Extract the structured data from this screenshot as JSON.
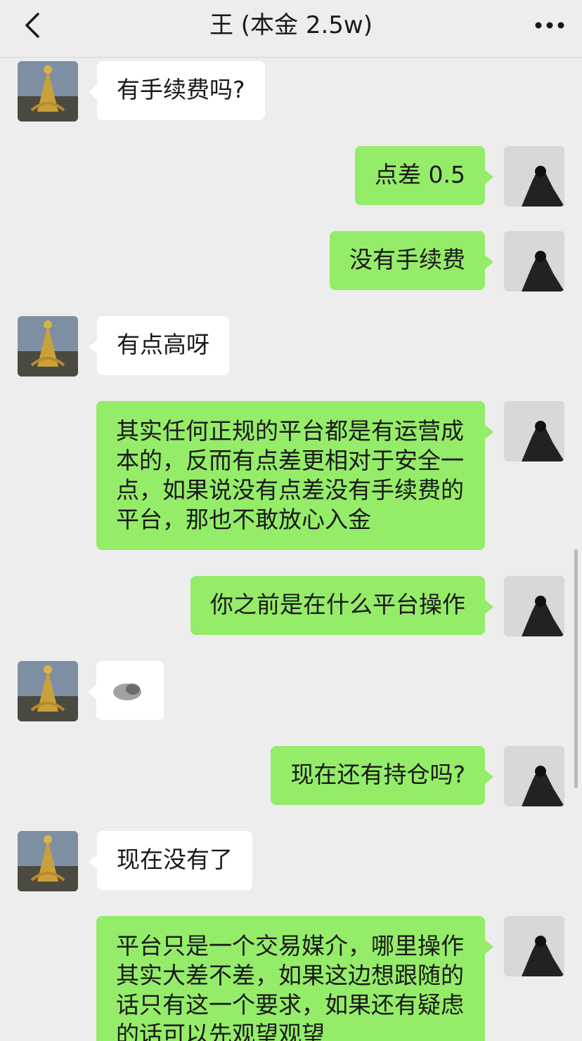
{
  "header": {
    "title": "王 (本金 2.5w)",
    "back_icon": "chevron-left-icon",
    "more_icon": "more-dots-icon"
  },
  "colors": {
    "background": "#ededed",
    "outgoing_bubble": "#95ec69",
    "incoming_bubble": "#ffffff",
    "text": "#191919"
  },
  "messages": [
    {
      "direction": "in",
      "text": "有手续费吗?"
    },
    {
      "direction": "out",
      "text": "点差 0.5"
    },
    {
      "direction": "out",
      "text": "没有手续费"
    },
    {
      "direction": "in",
      "text": "有点高呀"
    },
    {
      "direction": "out",
      "text": "其实任何正规的平台都是有运营成本的，反而有点差更相对于安全一点，如果说没有点差没有手续费的平台，那也不敢放心入金"
    },
    {
      "direction": "out",
      "text": "你之前是在什么平台操作"
    },
    {
      "direction": "in",
      "text": ""
    },
    {
      "direction": "out",
      "text": "现在还有持仓吗?"
    },
    {
      "direction": "in",
      "text": "现在没有了"
    },
    {
      "direction": "out",
      "text": "平台只是一个交易媒介，哪里操作其实大差不差，如果这边想跟随的话只有这一个要求，如果还有疑虑的话可以先观望观望"
    }
  ]
}
